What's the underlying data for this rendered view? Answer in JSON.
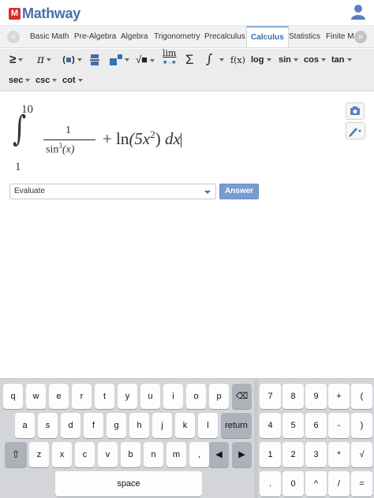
{
  "header": {
    "logo_mark": "M",
    "logo_text": "Mathway",
    "user_icon": "user-icon"
  },
  "tabs": {
    "items": [
      "Basic Math",
      "Pre-Algebra",
      "Algebra",
      "Trigonometry",
      "Precalculus",
      "Calculus",
      "Statistics",
      "Finite M"
    ],
    "active": "Calculus",
    "left_arrow": "«",
    "right_arrow": "»"
  },
  "toolbar": {
    "row1": [
      "≥",
      "π",
      "(■)",
      "fraction",
      "exponent",
      "√■",
      "lim",
      "Σ",
      "∫",
      "f(x)",
      "log",
      "sin",
      "cos",
      "tan"
    ],
    "row2": [
      "sec",
      "csc",
      "cot"
    ],
    "lim_sub": "■→■"
  },
  "expression": {
    "upper_limit": "10",
    "lower_limit": "1",
    "numerator": "1",
    "denominator_fn": "sin",
    "denominator_power": "3",
    "denominator_arg": "(x)",
    "rest_prefix": "+ ln",
    "rest_inner": "(5x",
    "rest_power": "2",
    "rest_close": ")",
    "differential": "dx"
  },
  "evaluate": {
    "selected": "Evaluate",
    "answer_label": "Answer"
  },
  "keyboard": {
    "row1": [
      "q",
      "w",
      "e",
      "r",
      "t",
      "y",
      "u",
      "i",
      "o",
      "p"
    ],
    "backspace": "⌫",
    "row2": [
      "a",
      "s",
      "d",
      "f",
      "g",
      "h",
      "j",
      "k",
      "l"
    ],
    "return": "return",
    "shift": "⇧",
    "row3": [
      "z",
      "x",
      "c",
      "v",
      "b",
      "n",
      "m",
      ","
    ],
    "left_arrow": "◀",
    "right_arrow": "▶",
    "space": "space",
    "numpad_row1": [
      "7",
      "8",
      "9",
      "+",
      "("
    ],
    "numpad_row2": [
      "4",
      "5",
      "6",
      "-",
      ")"
    ],
    "numpad_row3": [
      "1",
      "2",
      "3",
      "*",
      "√"
    ],
    "numpad_row4": [
      ".",
      "0",
      "^",
      "/",
      "="
    ]
  },
  "colors": {
    "brand_red": "#d9302c",
    "brand_blue": "#4a6fa5",
    "active_tab": "#3a6fb0",
    "answer_button": "#7b9bd0"
  }
}
